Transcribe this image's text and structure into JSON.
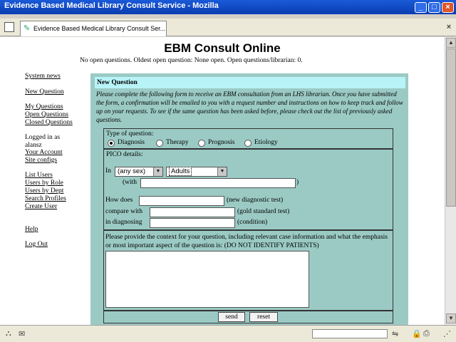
{
  "window": {
    "title": "Evidence Based Medical Library Consult Service - Mozilla",
    "subtitle": "http://ebm.lhs/consult"
  },
  "tab": {
    "label": "Evidence Based Medical Library Consult Ser..."
  },
  "page": {
    "heading": "EBM Consult Online",
    "status": "No open questions.    Oldest open question: None open.    Open questions/librarian: 0."
  },
  "nav": {
    "system_news": "System news",
    "new_question": "New Question",
    "my_questions": "My Questions",
    "open_questions": "Open Questions",
    "closed_questions": "Closed Questions",
    "logged_in_as": "Logged in as",
    "username": "alansz",
    "your_account": "Your Account",
    "site_configs": "Site configs",
    "list_users": "List Users",
    "users_by_role": "Users by Role",
    "users_by_dept": "Users by Dept",
    "search_profiles": "Search Profiles",
    "create_user": "Create User",
    "help": "Help",
    "log_out": "Log Out"
  },
  "form": {
    "header": "New Question",
    "instructions": "Please complete the following form to receive an EBM consultation from an LHS librarian. Once you have submitted the form, a confirmation will be emailed to you with a request number and instructions on how to keep track and follow up on your requests. To see if the same question has been asked before, please check out the list of previously asked questions.",
    "type_label": "Type of question:",
    "types": [
      "Diagnosis",
      "Therapy",
      "Prognosis",
      "Etiology"
    ],
    "selected_type": "Diagnosis",
    "pico_label": "PICO details:",
    "in_label": "In",
    "sex_value": "(any sex)",
    "age_value": "Adults",
    "with_label": "(with",
    "with_close": ")",
    "how_does_label": "How does",
    "how_does_hint": "(new diagnostic test)",
    "compare_label": "compare with",
    "compare_hint": "(gold standard test)",
    "diagnosing_label": "in diagnosing",
    "diagnosing_hint": "(condition)",
    "context_label": "Please provide the context for your question, including relevant case information and what the emphasis or most important aspect of the question is: (DO NOT IDENTIFY PATIENTS)",
    "send_label": "send",
    "reset_label": "reset"
  }
}
